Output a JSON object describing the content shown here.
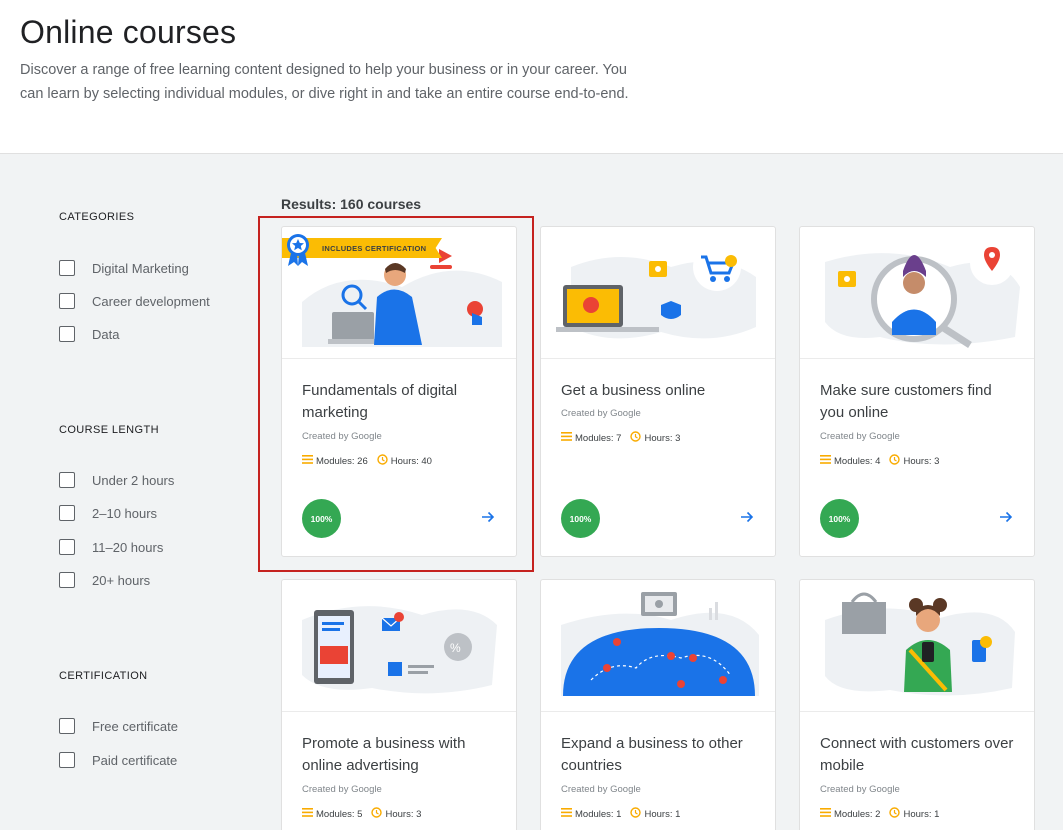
{
  "header": {
    "title": "Online courses",
    "description": "Discover a range of free learning content designed to help your business or in your career. You can learn by selecting individual modules, or dive right in and take an entire course end-to-end."
  },
  "filters": {
    "categories": {
      "title": "CATEGORIES",
      "options": [
        "Digital Marketing",
        "Career development",
        "Data"
      ]
    },
    "course_length": {
      "title": "COURSE LENGTH",
      "options": [
        "Under 2 hours",
        "2–10 hours",
        "11–20 hours",
        "20+ hours"
      ]
    },
    "certification": {
      "title": "CERTIFICATION",
      "options": [
        "Free certificate",
        "Paid certificate"
      ]
    }
  },
  "results": {
    "label": "Results: 160 courses"
  },
  "cards": [
    {
      "title": "Fundamentals of digital marketing",
      "creator": "Created by Google",
      "modules": "Modules: 26",
      "hours": "Hours: 40",
      "progress": "100%",
      "banner": "INCLUDES CERTIFICATION",
      "selected": true
    },
    {
      "title": "Get a business online",
      "creator": "Created by Google",
      "modules": "Modules: 7",
      "hours": "Hours: 3",
      "progress": "100%"
    },
    {
      "title": "Make sure customers find you online",
      "creator": "Created by Google",
      "modules": "Modules: 4",
      "hours": "Hours: 3",
      "progress": "100%"
    },
    {
      "title": "Promote a business with online advertising",
      "creator": "Created by Google",
      "modules": "Modules: 5",
      "hours": "Hours: 3"
    },
    {
      "title": "Expand a business to other countries",
      "creator": "Created by Google",
      "modules": "Modules: 1",
      "hours": "Hours: 1"
    },
    {
      "title": "Connect with customers over mobile",
      "creator": "Created by Google",
      "modules": "Modules: 2",
      "hours": "Hours: 1"
    }
  ],
  "colors": {
    "accent_blue": "#1a73e8",
    "progress_green": "#34a853",
    "certification_yellow": "#fbbc04",
    "selection_red": "#c5221f"
  },
  "icons": {
    "modules": "list-lines-icon",
    "hours": "clock-icon",
    "open": "arrow-right-icon",
    "certification": "ribbon-star-icon"
  }
}
